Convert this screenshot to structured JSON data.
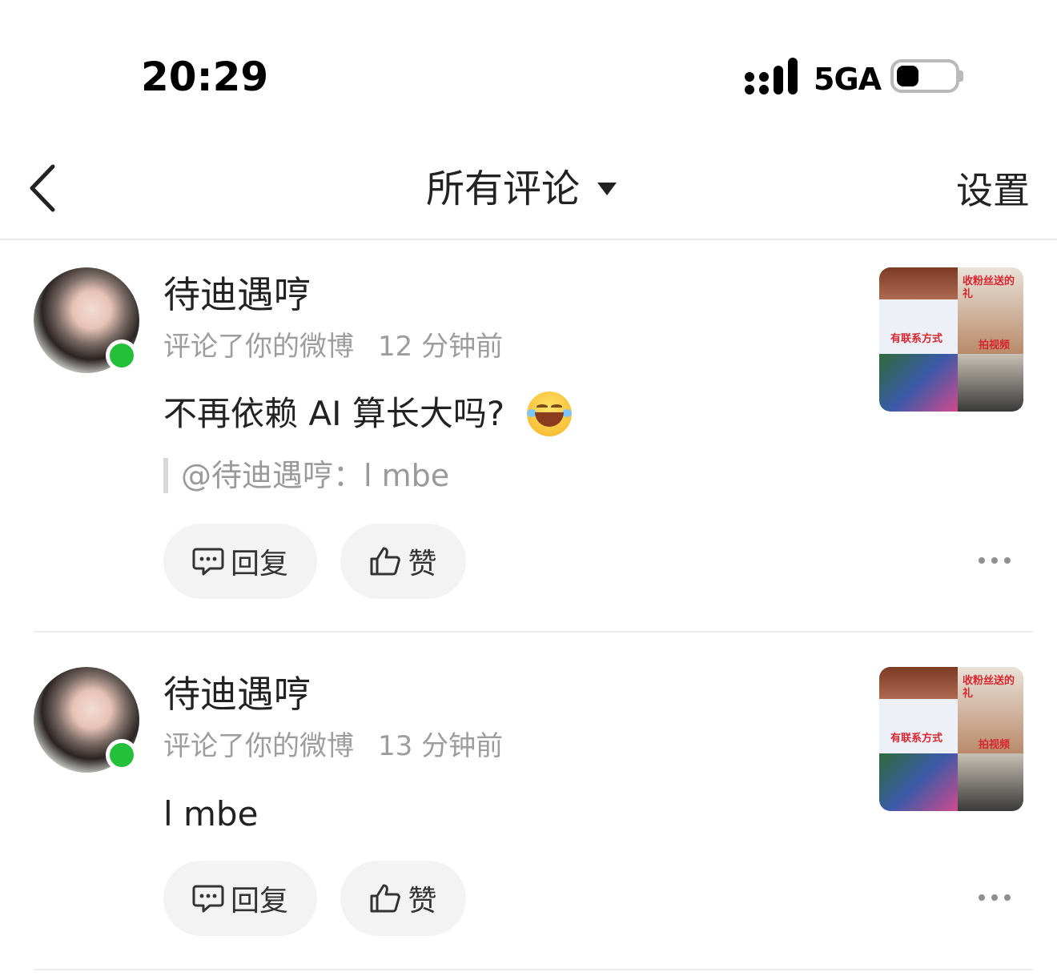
{
  "status_bar": {
    "time": "20:29",
    "network": "5GA",
    "battery_level": 0.35
  },
  "nav": {
    "title": "所有评论",
    "settings": "设置",
    "icons": {
      "back": "chevron-left-icon",
      "caret": "caret-down-icon"
    }
  },
  "comments": [
    {
      "user": "待迪遇哼",
      "action": "评论了你的微博",
      "time": "12 分钟前",
      "text": "不再依赖 AI 算长大吗?",
      "emoji": "😂",
      "quote": "@待迪遇哼：l   mbe",
      "reply_label": "回复",
      "like_label": "赞",
      "thumb_texts": [
        "收粉丝送的礼",
        "有联系方式",
        "拍视频"
      ]
    },
    {
      "user": "待迪遇哼",
      "action": "评论了你的微博",
      "time": "13 分钟前",
      "text": "l   mbe",
      "reply_label": "回复",
      "like_label": "赞",
      "thumb_texts": [
        "收粉丝送的礼",
        "有联系方式",
        "拍视频"
      ]
    }
  ],
  "colors": {
    "online": "#25c03a",
    "meta_text": "#9d9d9d",
    "pill_bg": "#f3f3f3"
  }
}
